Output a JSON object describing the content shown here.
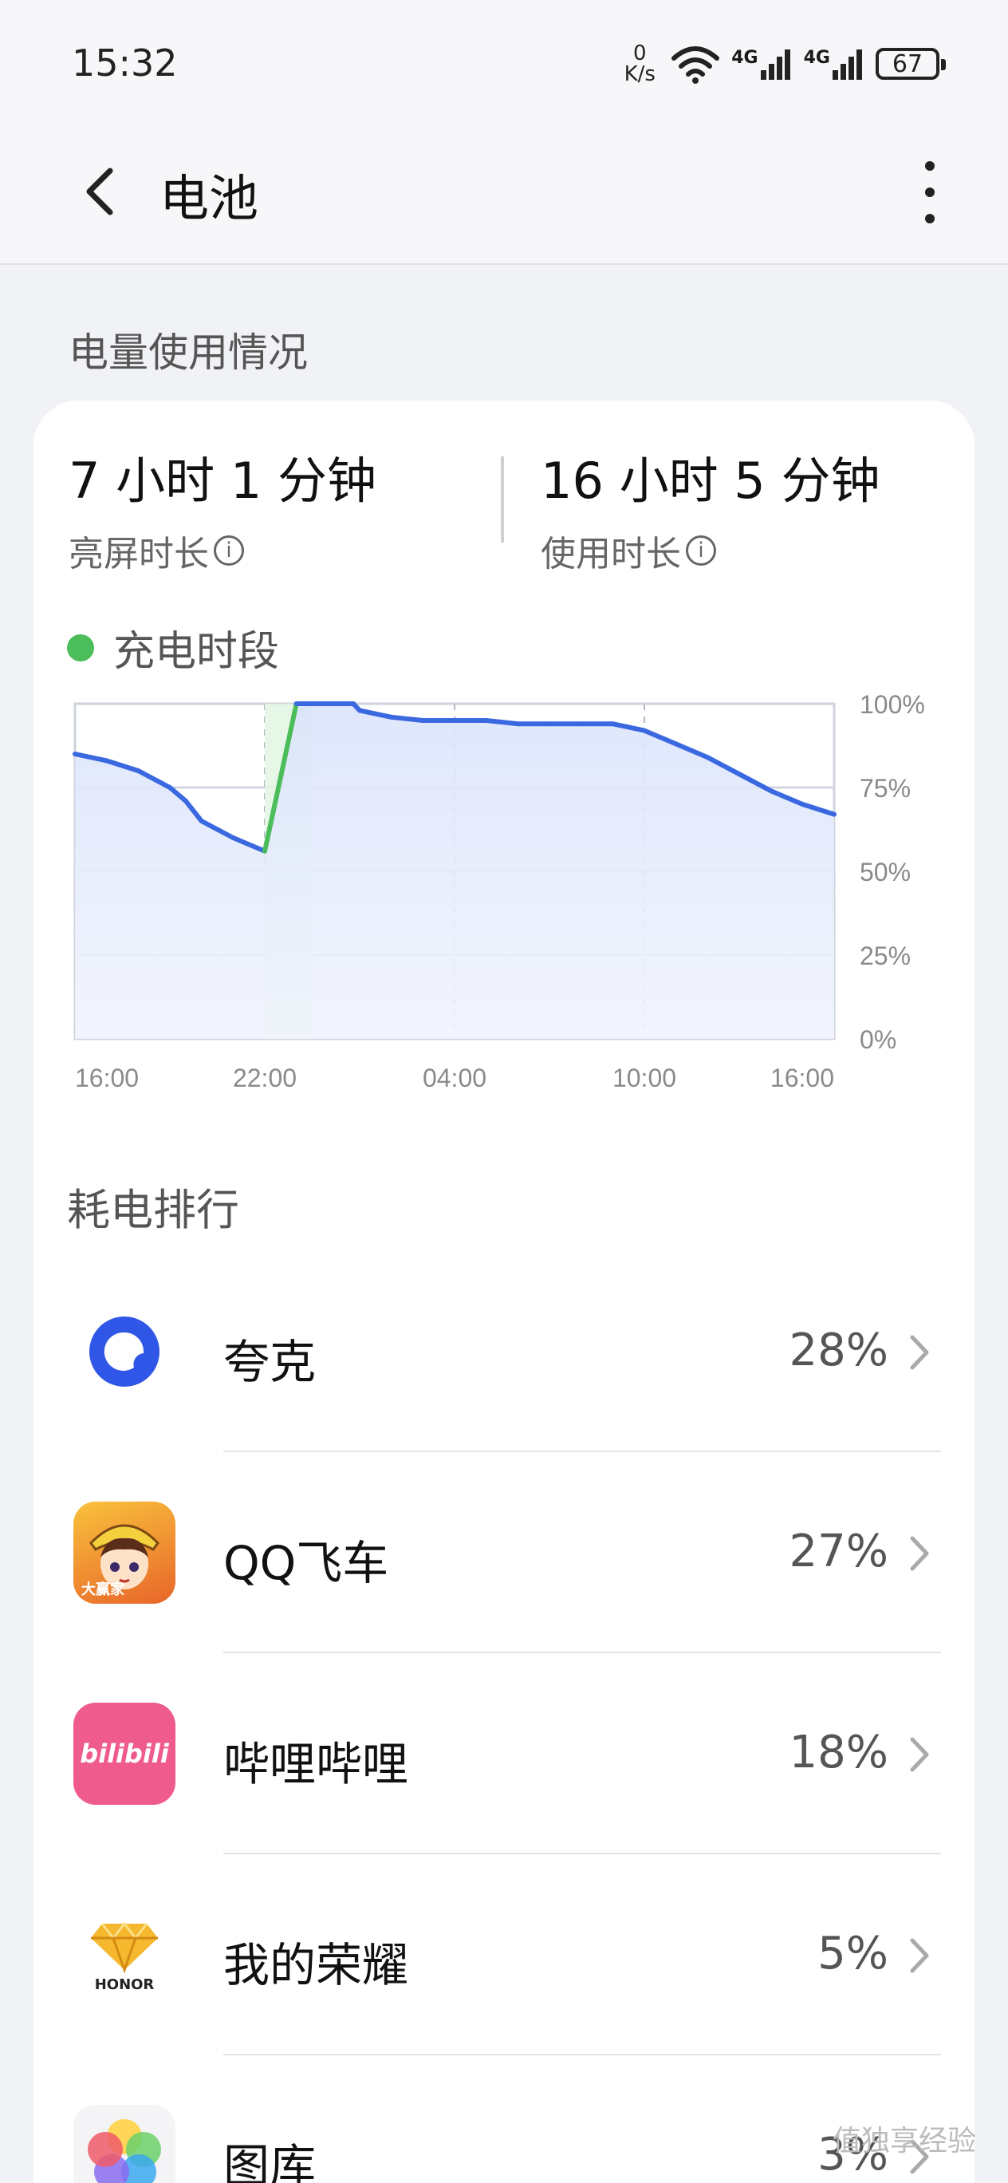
{
  "status_bar": {
    "time": "15:32",
    "net_speed_value": "0",
    "net_speed_unit": "K/s",
    "signal_1": "4G",
    "signal_2": "4G",
    "battery_level": "67"
  },
  "header": {
    "title": "电池"
  },
  "usage_section": {
    "title": "电量使用情况"
  },
  "metrics": {
    "screen_on": {
      "value": "7 小时 1 分钟",
      "label": "亮屏时长"
    },
    "usage": {
      "value": "16 小时 5 分钟",
      "label": "使用时长"
    }
  },
  "chart_legend": {
    "label": "充电时段",
    "color": "#4cbd5b"
  },
  "chart_data": {
    "type": "area",
    "x_tick_labels": [
      "16:00",
      "22:00",
      "04:00",
      "10:00",
      "16:00"
    ],
    "y_tick_labels": [
      "100%",
      "75%",
      "50%",
      "25%",
      "0%"
    ],
    "ylim": [
      0,
      100
    ],
    "grid": true,
    "x_hours": [
      0,
      1,
      2,
      3,
      3.5,
      4,
      5,
      6,
      7,
      8,
      8.8,
      9,
      10,
      11,
      12,
      13,
      14,
      15,
      16,
      17,
      18,
      19,
      20,
      21,
      22,
      23,
      24
    ],
    "battery": [
      85,
      83,
      80,
      75,
      71,
      65,
      60,
      56,
      100,
      100,
      100,
      98,
      96,
      95,
      95,
      95,
      94,
      94,
      94,
      94,
      92,
      88,
      84,
      79,
      74,
      70,
      67
    ],
    "charging_from_hour": 6,
    "charging_to_hour": 7.5,
    "line_color": "#3a68e0",
    "charge_color": "#4cbd5b",
    "fill_color": "#dbe4fb"
  },
  "ranking": {
    "title": "耗电排行",
    "apps": [
      {
        "name": "夸克",
        "percent": "28%",
        "icon": "quark-icon"
      },
      {
        "name": "QQ飞车",
        "percent": "27%",
        "icon": "qq-speed-icon",
        "icon_text": "大赢家"
      },
      {
        "name": "哔哩哔哩",
        "percent": "18%",
        "icon": "bilibili-icon",
        "icon_text": "bilibili"
      },
      {
        "name": "我的荣耀",
        "percent": "5%",
        "icon": "honor-icon",
        "icon_text": "HONOR"
      },
      {
        "name": "图库",
        "percent": "3%",
        "icon": "gallery-icon"
      }
    ]
  },
  "watermark": "值独享经验"
}
